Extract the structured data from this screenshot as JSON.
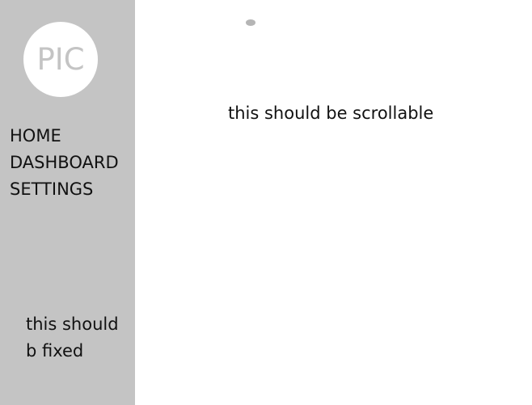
{
  "sidebar": {
    "avatar_text": "PIC",
    "nav": [
      {
        "label": "HOME"
      },
      {
        "label": "DASHBOARD"
      },
      {
        "label": "SETTINGS"
      }
    ],
    "footer_line1": "this should",
    "footer_line2": "b fixed"
  },
  "main": {
    "text": "this should be scrollable"
  },
  "colors": {
    "sidebar_bg": "#c4c4c4",
    "avatar_bg": "#ffffff",
    "main_bg": "#ffffff",
    "text": "#111111"
  }
}
